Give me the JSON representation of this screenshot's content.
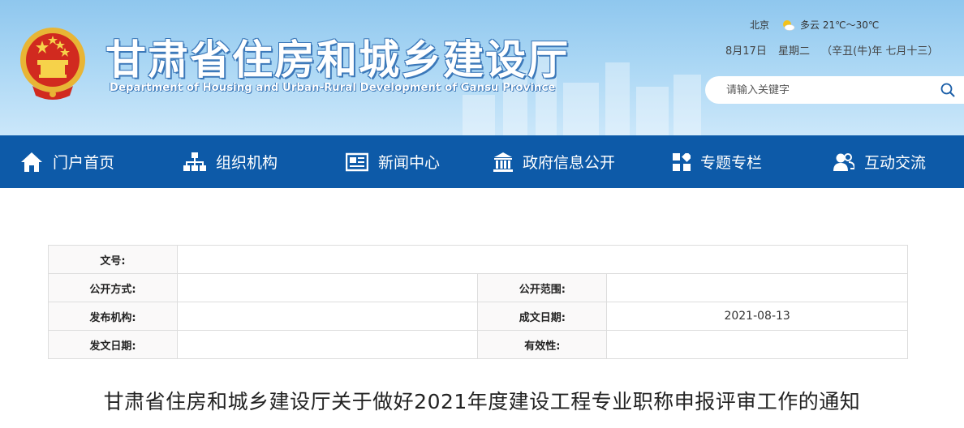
{
  "header": {
    "title": "甘肃省住房和城乡建设厅",
    "subtitle": "Department of Housing and Urban-Rural Development of Gansu Province",
    "weather": {
      "city": "北京",
      "condition": "多云 21℃～30℃",
      "icon": "partly-cloudy-icon"
    },
    "date": {
      "day": "8月17日",
      "weekday": "星期二",
      "lunar": "（辛丑(牛)年 七月十三）"
    },
    "search": {
      "placeholder": "请输入关键字",
      "value": ""
    }
  },
  "nav": {
    "items": [
      {
        "label": "门户首页",
        "icon": "home-icon"
      },
      {
        "label": "组织机构",
        "icon": "org-chart-icon"
      },
      {
        "label": "新闻中心",
        "icon": "news-icon"
      },
      {
        "label": "政府信息公开",
        "icon": "government-building-icon"
      },
      {
        "label": "专题专栏",
        "icon": "grid-icon"
      },
      {
        "label": "互动交流",
        "icon": "users-icon"
      }
    ],
    "colors": {
      "bar": "#0d5aa8",
      "text": "#ffffff"
    }
  },
  "info_table": {
    "doc_no_label": "文号:",
    "doc_no_value": "",
    "method_label": "公开方式:",
    "method_value": "",
    "scope_label": "公开范围:",
    "scope_value": "",
    "issuer_label": "发布机构:",
    "issuer_value": "",
    "date_label": "成文日期:",
    "date_value": "2021-08-13",
    "issue_date_label": "发文日期:",
    "issue_date_value": "",
    "validity_label": "有效性:",
    "validity_value": ""
  },
  "article": {
    "title": "甘肃省住房和城乡建设厅关于做好2021年度建设工程专业职称申报评审工作的通知"
  }
}
